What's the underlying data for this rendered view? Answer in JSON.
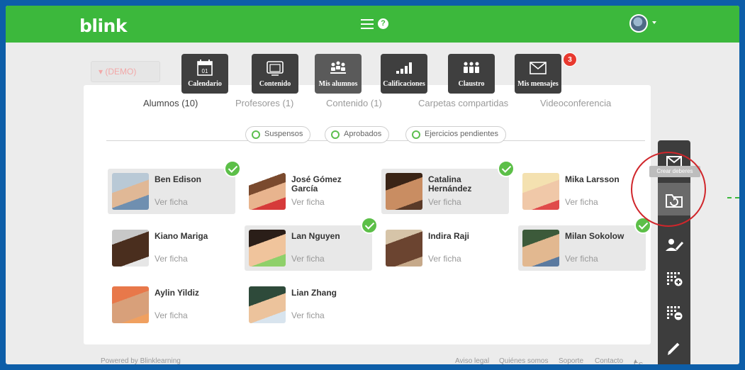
{
  "app": {
    "logo": "blink",
    "help_icon": "?"
  },
  "background_tabs": [
    {
      "label": "(DEMO)"
    }
  ],
  "toolbar": [
    {
      "label": "Calendario",
      "icon": "calendar-icon",
      "icon_text": "01"
    },
    {
      "label": "Contenido",
      "icon": "content-icon"
    },
    {
      "label": "Mis alumnos",
      "icon": "students-icon"
    },
    {
      "label": "Calificaciones",
      "icon": "grades-icon"
    },
    {
      "label": "Claustro",
      "icon": "staff-icon"
    },
    {
      "label": "Mis mensajes",
      "icon": "mail-icon",
      "badge": "3"
    }
  ],
  "card_tabs": [
    {
      "label": "Alumnos (10)",
      "active": true
    },
    {
      "label": "Profesores (1)"
    },
    {
      "label": "Contenido (1)"
    },
    {
      "label": "Carpetas compartidas"
    },
    {
      "label": "Videoconferencia"
    }
  ],
  "filters": [
    {
      "label": "Suspensos"
    },
    {
      "label": "Aprobados"
    },
    {
      "label": "Ejercicios pendientes"
    }
  ],
  "ficha_label": "Ver ficha",
  "students": [
    {
      "name": "Ben Edison",
      "done": true
    },
    {
      "name": "José Gómez García",
      "done": false
    },
    {
      "name": "Catalina Hernández",
      "done": true
    },
    {
      "name": "Mika Larsson",
      "done": false
    },
    {
      "name": "Kiano Mariga",
      "done": false
    },
    {
      "name": "Lan Nguyen",
      "done": true
    },
    {
      "name": "Indira Raji",
      "done": false
    },
    {
      "name": "Milan Sokolow",
      "done": true
    },
    {
      "name": "Aylin Yildiz",
      "done": false
    },
    {
      "name": "Lian Zhang",
      "done": false
    }
  ],
  "sidebar": {
    "tooltip": "Crear deberes",
    "items": [
      {
        "icon": "mail-icon"
      },
      {
        "icon": "create-homework-icon",
        "active": true
      },
      {
        "icon": "user-edit-icon"
      },
      {
        "icon": "grid-add-icon"
      },
      {
        "icon": "grid-remove-icon"
      },
      {
        "icon": "pencil-icon"
      }
    ]
  },
  "footer": {
    "powered": "Powered by Blinklearning",
    "links": [
      "Aviso legal",
      "Quiénes somos",
      "Soporte",
      "Contacto",
      "ES"
    ]
  },
  "colors": {
    "brand_green": "#3cb83c",
    "toolbar_dark": "#3f3f3f",
    "badge_red": "#e8392f",
    "check_green": "#5cbf48",
    "highlight_red": "#d0262b"
  }
}
